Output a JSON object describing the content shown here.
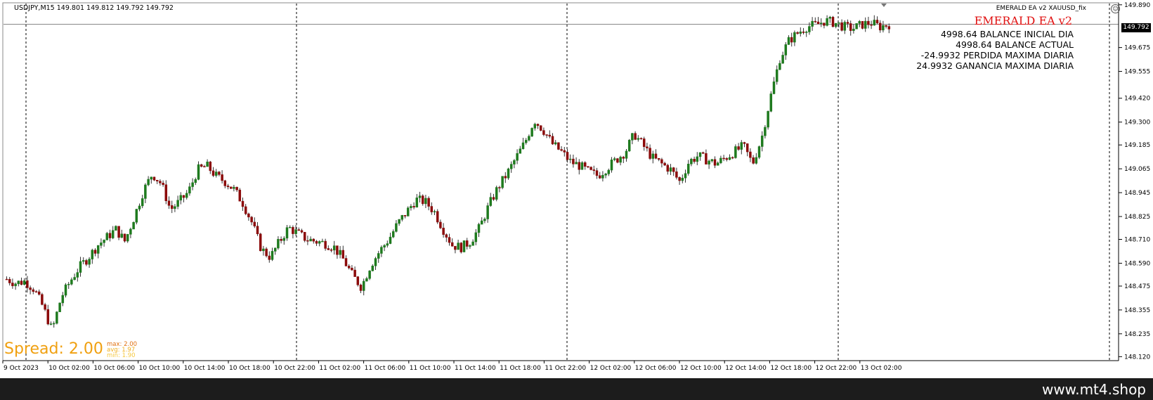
{
  "header": {
    "symbol_line": "USDJPY,M15  149.801 149.812 149.792 149.792",
    "ea_label": "EMERALD EA  v2 XAUUSD_fix"
  },
  "ea_panel": {
    "title": "EMERALD EA v2",
    "lines": [
      "4998.64 BALANCE INICIAL DIA",
      "4998.64 BALANCE ACTUAL",
      "-24.9932 PERDIDA MAXIMA DIARIA",
      "24.9932 GANANCIA MAXIMA DIARIA"
    ]
  },
  "spread": {
    "label": "Spread: 2.00",
    "max": "max: 2.00",
    "avg": "avg: 1.97",
    "min": "min: 1.90"
  },
  "price_axis": {
    "labels": [
      "149.890",
      "149.792",
      "149.675",
      "149.555",
      "149.420",
      "149.300",
      "149.185",
      "149.065",
      "148.945",
      "148.825",
      "148.710",
      "148.590",
      "148.475",
      "148.355",
      "148.235",
      "148.120"
    ],
    "current_price": "149.792"
  },
  "time_axis": {
    "labels": [
      "9 Oct 2023",
      "10 Oct 02:00",
      "10 Oct 06:00",
      "10 Oct 10:00",
      "10 Oct 14:00",
      "10 Oct 18:00",
      "10 Oct 22:00",
      "11 Oct 02:00",
      "11 Oct 06:00",
      "11 Oct 10:00",
      "11 Oct 14:00",
      "11 Oct 18:00",
      "11 Oct 22:00",
      "12 Oct 02:00",
      "12 Oct 06:00",
      "12 Oct 10:00",
      "12 Oct 14:00",
      "12 Oct 18:00",
      "12 Oct 22:00",
      "13 Oct 02:00"
    ]
  },
  "colors": {
    "bull": "#1e7a1e",
    "bear": "#8b0a0a",
    "wick": "#333333",
    "grid": "#000000",
    "spread": "#f0a010",
    "ea_title": "#e01010"
  },
  "footer": {
    "brand": "www.mt4.shop"
  },
  "chart_data": {
    "type": "candlestick",
    "symbol": "USDJPY",
    "timeframe": "M15",
    "ylim": [
      148.1,
      149.9
    ],
    "close_path": [
      148.51,
      148.49,
      148.5,
      148.46,
      148.37,
      148.25,
      148.42,
      148.5,
      148.57,
      148.62,
      148.68,
      148.72,
      148.76,
      148.7,
      148.82,
      148.95,
      149.04,
      148.99,
      148.86,
      148.9,
      148.95,
      149.06,
      149.08,
      149.03,
      149.0,
      148.96,
      148.89,
      148.79,
      148.66,
      148.62,
      148.7,
      148.77,
      148.74,
      148.71,
      148.7,
      148.69,
      148.67,
      148.61,
      148.53,
      148.47,
      148.58,
      148.65,
      148.71,
      148.79,
      148.85,
      148.91,
      148.9,
      148.85,
      148.76,
      148.68,
      148.67,
      148.7,
      148.77,
      148.88,
      148.97,
      149.04,
      149.12,
      149.2,
      149.31,
      149.26,
      149.19,
      149.15,
      149.1,
      149.08,
      149.05,
      149.03,
      149.07,
      149.11,
      149.15,
      149.24,
      149.18,
      149.12,
      149.09,
      149.06,
      149.0,
      149.1,
      149.13,
      149.11,
      149.09,
      149.12,
      149.15,
      149.18,
      149.09,
      149.22,
      149.43,
      149.62,
      149.71,
      149.75,
      149.78,
      149.79,
      149.81,
      149.8,
      149.78,
      149.77,
      149.79,
      149.8,
      149.78,
      149.792
    ]
  }
}
